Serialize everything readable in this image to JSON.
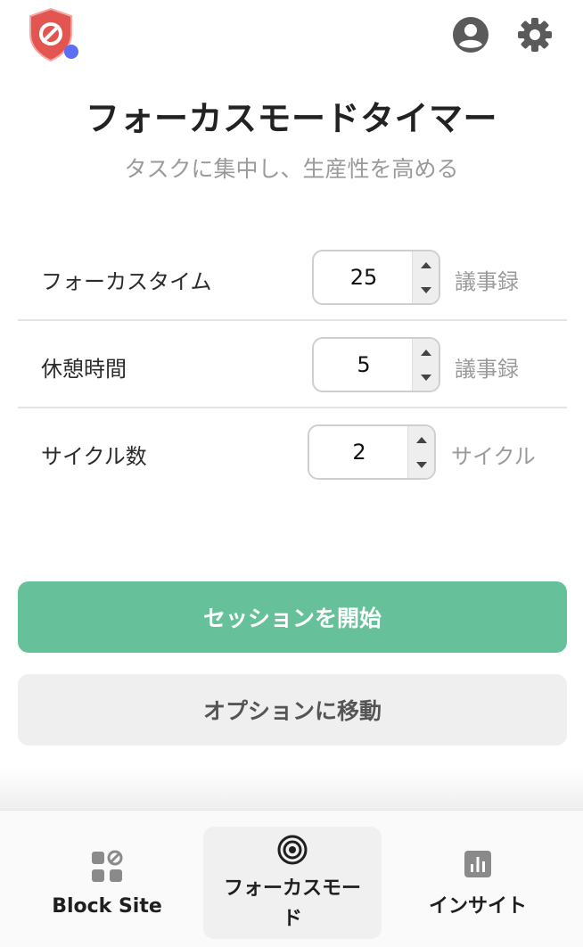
{
  "header": {
    "logo_icon": "blocked-shield-icon",
    "status_dot_color": "#5b6ef5",
    "account_icon": "account-circle-icon",
    "settings_icon": "gear-icon"
  },
  "page": {
    "title": "フォーカスモードタイマー",
    "subtitle": "タスクに集中し、生産性を高める"
  },
  "settings": {
    "focus_time": {
      "label": "フォーカスタイム",
      "value": "25",
      "unit": "議事録"
    },
    "break_time": {
      "label": "休憩時間",
      "value": "5",
      "unit": "議事録"
    },
    "cycles": {
      "label": "サイクル数",
      "value": "2",
      "unit": "サイクル"
    }
  },
  "actions": {
    "start_label": "セッションを開始",
    "options_label": "オプションに移動",
    "accent_color": "#66c09a"
  },
  "nav": {
    "block_site": {
      "label": "Block Site",
      "icon": "apps-block-icon"
    },
    "focus_mode": {
      "label_line1": "フォーカスモー",
      "label_line2": "ド",
      "icon": "target-icon",
      "active": true
    },
    "insights": {
      "label": "インサイト",
      "icon": "bar-chart-icon"
    }
  }
}
